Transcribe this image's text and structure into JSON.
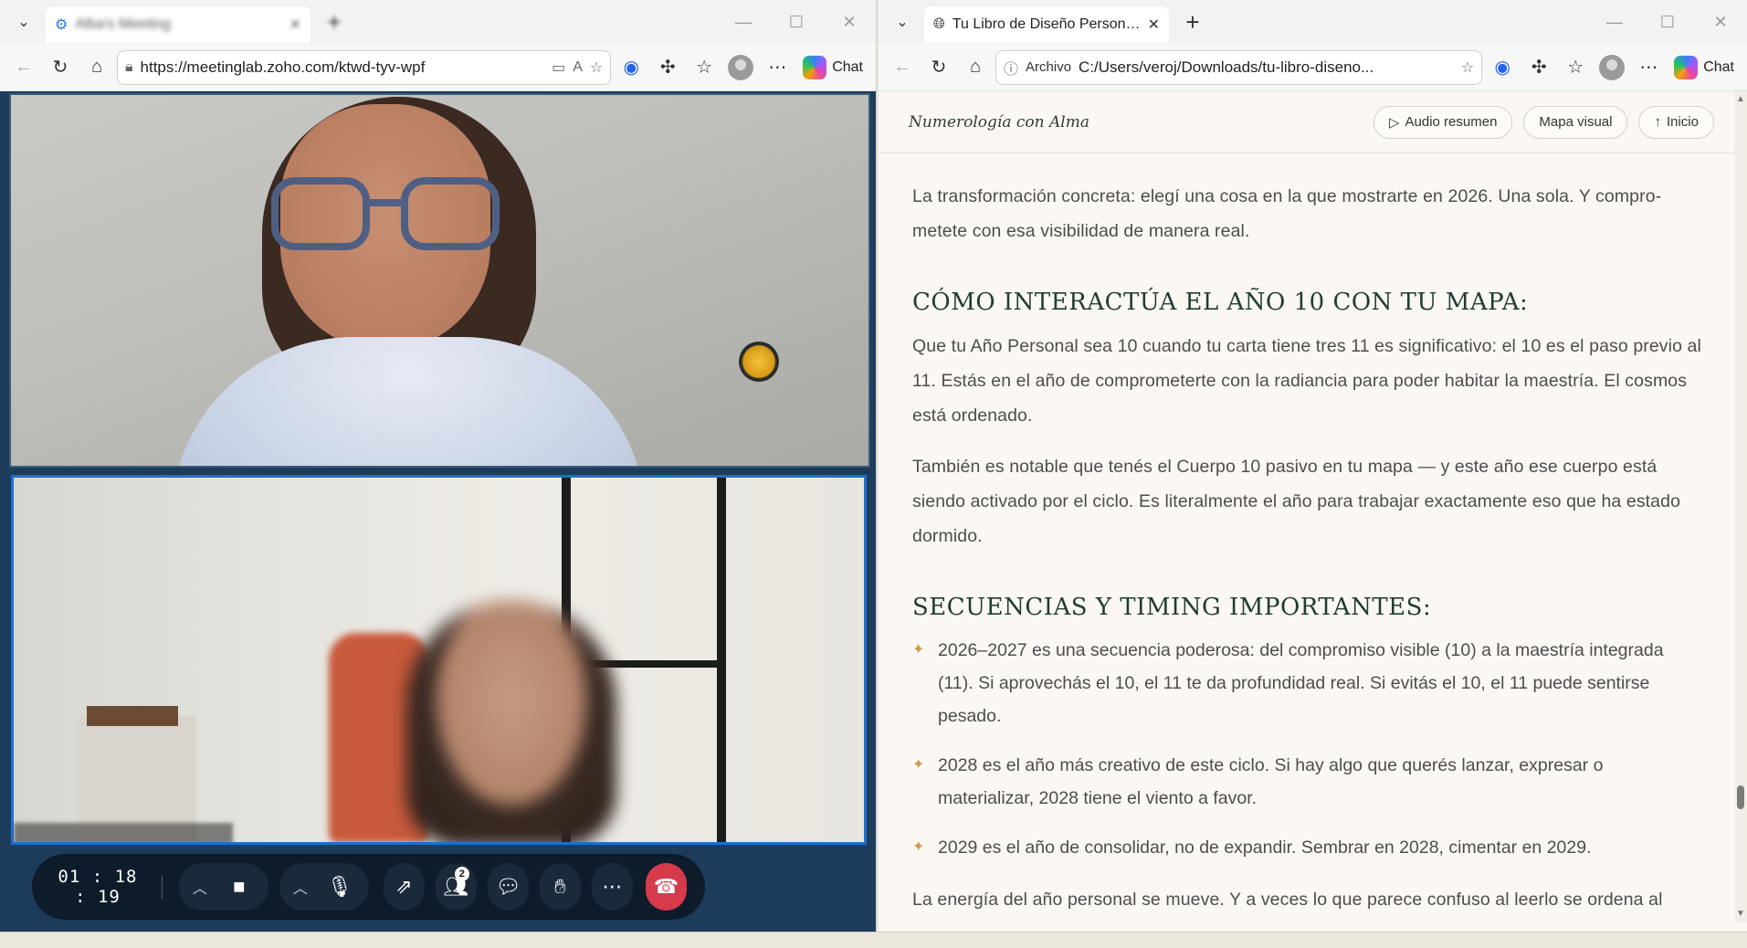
{
  "left_browser": {
    "tab_title": "Alba's Meeting",
    "url": "https://meetinglab.zoho.com/ktwd-tyv-wpf",
    "copilot_label": "Chat"
  },
  "meeting": {
    "timer": "01 : 18 : 19",
    "participants_count": "2"
  },
  "right_browser": {
    "tab_title": "Tu Libro de Diseño Personal — Mapa",
    "address_prefix": "Archivo",
    "url": "C:/Users/veroj/Downloads/tu-libro-diseno...",
    "copilot_label": "Chat"
  },
  "doc": {
    "brand": "Numerología con Alma",
    "nav": {
      "audio": "Audio resumen",
      "map": "Mapa visual",
      "home": "Inicio"
    },
    "intro": "La transformación concreta: elegí una cosa en la que mostrarte en 2026. Una sola. Y compro­metete con esa visibilidad de manera real.",
    "section1_title": "CÓMO INTERACTÚA EL AÑO 10 CON TU MAPA:",
    "section1_p1": "Que tu Año Personal sea 10 cuando tu carta tiene tres 11 es significativo: el 10 es el paso previo al 11. Estás en el año de comprometerte con la radiancia para poder habitar la maestría. El cos­mos está ordenado.",
    "section1_p2": "También es notable que tenés el Cuerpo 10 pasivo en tu mapa — y este año ese cuerpo está siendo activado por el ciclo. Es literalmente el año para trabajar exactamente eso que ha es­tado dormido.",
    "section2_title": "SECUENCIAS Y TIMING IMPORTANTES:",
    "bullets": [
      "2026–2027 es una secuencia poderosa: del compromiso visible (10) a la maestría integrada (11). Si aprovechás el 10, el 11 te da profundidad real. Si evitás el 10, el 11 puede sentirse pesado.",
      "2028 es el año más creativo de este ciclo. Si hay algo que querés lanzar, expresar o materializar, 2028 tiene el viento a favor.",
      "2029 es el año de consolidar, no de expandir. Sembrar en 2028, cimentar en 2029."
    ],
    "trailing": "La energía del año personal se mueve. Y a veces lo que parece confuso al leerlo se ordena al"
  },
  "colors": {
    "meeting_bg": "#1d3c5b",
    "end_call": "#d63a4b",
    "heading": "#1f3d32",
    "bullet_star": "#c89a52"
  }
}
